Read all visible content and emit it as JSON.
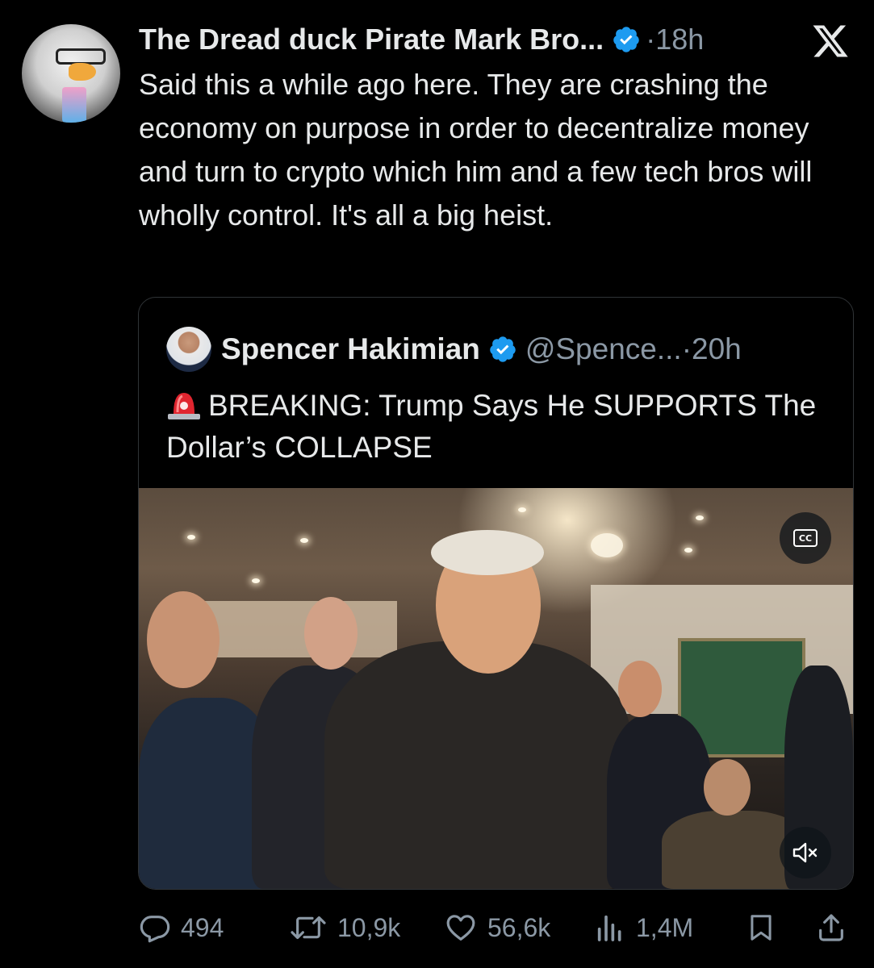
{
  "tweet": {
    "display_name": "The Dread duck Pirate Mark Bro...",
    "verified": true,
    "time": "18h",
    "text": "Said this a while ago here. They are crashing the economy on purpose in order to decentralize money and turn to crypto which him and a few tech bros will wholly control. It's all a big heist."
  },
  "quoted_tweet": {
    "display_name": "Spencer Hakimian",
    "verified": true,
    "handle": "@Spence...",
    "time": "20h",
    "text": "BREAKING: Trump Says He SUPPORTS The Dollar’s COLLAPSE",
    "media": {
      "type": "video",
      "captions_button": "CC",
      "muted": true
    }
  },
  "actions": {
    "replies": "494",
    "reposts": "10,9k",
    "likes": "56,6k",
    "views": "1,4M"
  },
  "colors": {
    "background": "#000000",
    "text": "#e7e9ea",
    "muted": "#8b98a5",
    "verified": "#1d9bf0",
    "border": "#2f3336"
  },
  "icons": {
    "close": "x-logo-icon",
    "reply": "reply-icon",
    "repost": "repost-icon",
    "like": "heart-icon",
    "views": "views-icon",
    "bookmark": "bookmark-icon",
    "share": "share-icon"
  }
}
